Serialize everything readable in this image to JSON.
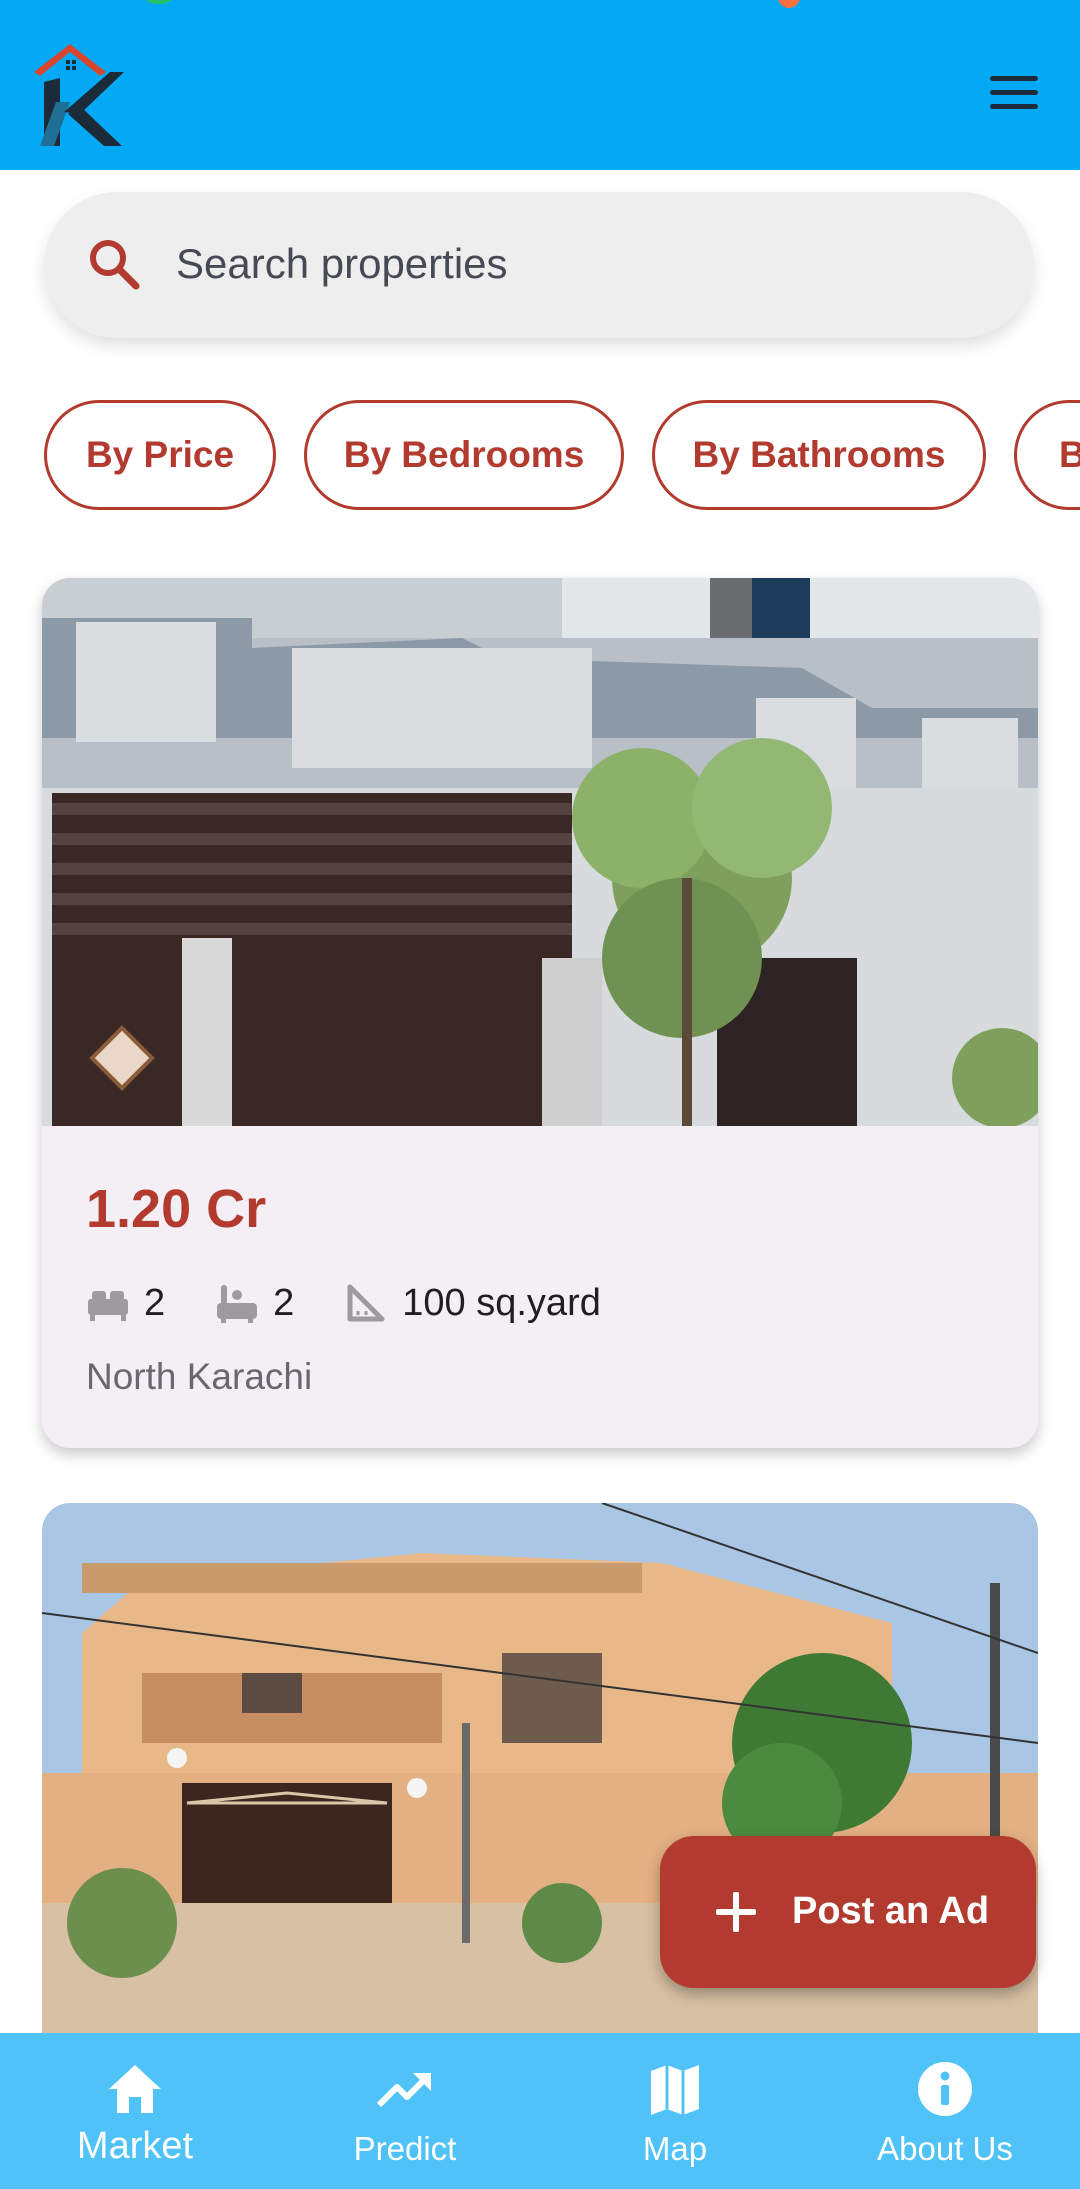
{
  "app_bar": {
    "logo_icon": "k-house-logo",
    "menu_icon": "hamburger-menu-icon"
  },
  "search": {
    "icon": "search-icon",
    "placeholder": "Search properties"
  },
  "filters": [
    "By Price",
    "By Bedrooms",
    "By Bathrooms",
    "B"
  ],
  "listings": [
    {
      "price": "1.20 Cr",
      "bedrooms": "2",
      "bathrooms": "2",
      "area": "100 sq.yard",
      "location": "North Karachi"
    }
  ],
  "fab": {
    "label": "Post an Ad",
    "icon": "plus-icon"
  },
  "bottom_nav": [
    {
      "label": "Market",
      "icon": "home-icon",
      "active": true
    },
    {
      "label": "Predict",
      "icon": "trending-up-icon",
      "active": false
    },
    {
      "label": "Map",
      "icon": "map-icon",
      "active": false
    },
    {
      "label": "About Us",
      "icon": "info-icon",
      "active": false
    }
  ],
  "colors": {
    "app_bar": "#03A9F4",
    "bottom_nav": "#4FC3F7",
    "accent": "#B23A2E",
    "card_bg": "#F4EFF5"
  }
}
